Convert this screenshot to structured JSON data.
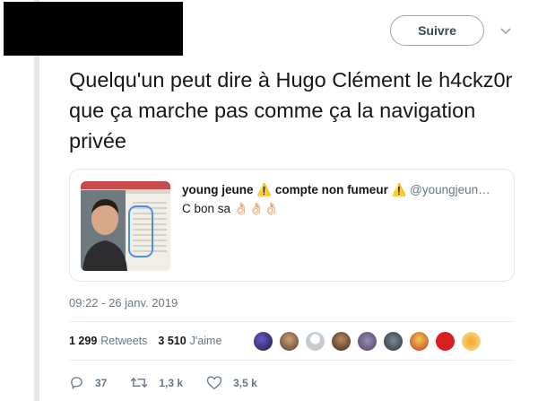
{
  "header": {
    "follow_label": "Suivre"
  },
  "tweet": {
    "text": "Quelqu'un peut dire à Hugo Clément le h4ckz0r que ça marche pas comme ça la navigation privée",
    "timestamp": "09:22 - 26 janv. 2019"
  },
  "quote": {
    "author_name": "young jeune ⚠️ compte non fumeur ⚠️",
    "author_handle": "@youngjeun…",
    "text": "C bon sa",
    "emojis": "👌🏻👌🏻👌🏻"
  },
  "stats": {
    "retweets_count": "1 299",
    "retweets_label": "Retweets",
    "likes_count": "3 510",
    "likes_label": "J'aime"
  },
  "actions": {
    "replies": "37",
    "retweets": "1,3 k",
    "likes": "3,5 k"
  },
  "colors": {
    "accent": "#4a90e2",
    "text": "#14171a",
    "muted": "#657786",
    "border": "#e1e8ed"
  },
  "icons": [
    "chevron-down-icon",
    "reply-icon",
    "retweet-icon",
    "heart-icon"
  ]
}
